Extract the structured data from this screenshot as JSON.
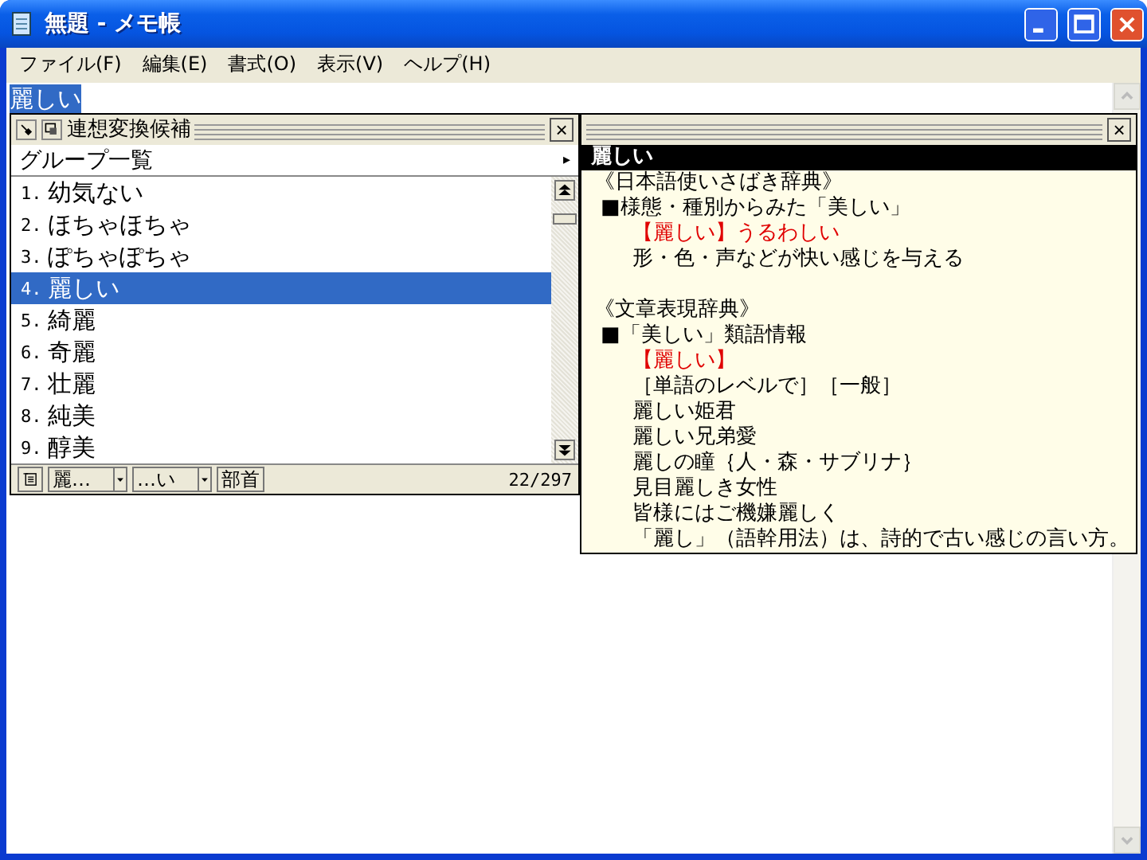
{
  "window": {
    "title": "無題 - メモ帳"
  },
  "menu": [
    {
      "label": "ファイル(F)"
    },
    {
      "label": "編集(E)"
    },
    {
      "label": "書式(O)"
    },
    {
      "label": "表示(V)"
    },
    {
      "label": "ヘルプ(H)"
    }
  ],
  "editor": {
    "text": "麗しい",
    "selected": true
  },
  "candidates": {
    "title": "連想変換候補",
    "close": "×",
    "group": "グループ一覧",
    "group_arrow": "▸",
    "items": [
      {
        "number": "1.",
        "text": "幼気ない",
        "selected": false
      },
      {
        "number": "2.",
        "text": "ほちゃほちゃ",
        "selected": false
      },
      {
        "number": "3.",
        "text": "ぽちゃぽちゃ",
        "selected": false
      },
      {
        "number": "4.",
        "text": "麗しい",
        "selected": true
      },
      {
        "number": "5.",
        "text": "綺麗",
        "selected": false
      },
      {
        "number": "6.",
        "text": "奇麗",
        "selected": false
      },
      {
        "number": "7.",
        "text": "壮麗",
        "selected": false
      },
      {
        "number": "8.",
        "text": "純美",
        "selected": false
      },
      {
        "number": "9.",
        "text": "醇美",
        "selected": false
      }
    ],
    "toolbar": {
      "first": "麗…",
      "second": "…い",
      "radical": "部首",
      "count": "22/297"
    }
  },
  "dictionary": {
    "close": "×",
    "heading": "麗しい",
    "lines": [
      {
        "kind": "source",
        "text": "《日本語使いさばき辞典》"
      },
      {
        "kind": "section",
        "text": "■様態・種別からみた「美しい」"
      },
      {
        "kind": "highlight",
        "text": "【麗しい】うるわしい"
      },
      {
        "kind": "body",
        "text": "形・色・声などが快い感じを与える"
      },
      {
        "kind": "source",
        "text": "《文章表現辞典》"
      },
      {
        "kind": "section",
        "text": "■「美しい」類語情報"
      },
      {
        "kind": "highlight",
        "text": "【麗しい】"
      },
      {
        "kind": "body",
        "text": "［単語のレベルで］［一般］"
      },
      {
        "kind": "body",
        "text": "麗しい姫君"
      },
      {
        "kind": "body",
        "text": "麗しい兄弟愛"
      },
      {
        "kind": "body",
        "text": "麗しの瞳｛人・森・サブリナ｝"
      },
      {
        "kind": "body",
        "text": "見目麗しき女性"
      },
      {
        "kind": "body",
        "text": "皆様にはご機嫌麗しく"
      },
      {
        "kind": "body",
        "text": "「麗し」（語幹用法）は、詩的で古い感じの言い方。"
      }
    ]
  }
}
